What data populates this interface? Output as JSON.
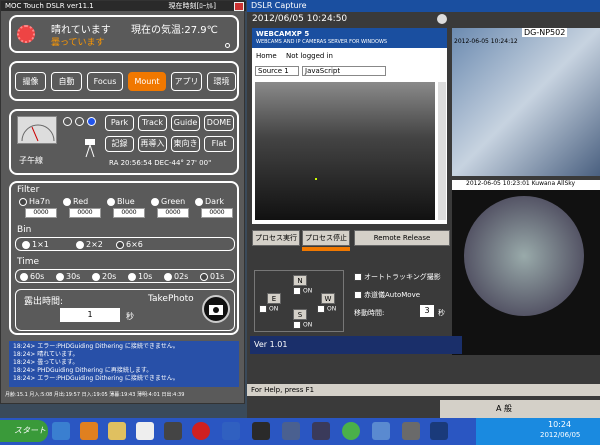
{
  "moc": {
    "title": "MOC Touch DSLR ver11.1",
    "title_right": "現在時刻[ﾛｰｶﾙ]",
    "weather": "晴れています",
    "weather_sub": "曇っています",
    "temp": "現在の気温:27.9℃",
    "tabs": [
      "撮像",
      "自動",
      "Focus",
      "Mount",
      "アプリ",
      "環境"
    ],
    "mount_buttons": [
      "Park",
      "Track",
      "Guide",
      "DOME",
      "記録",
      "再導入",
      "東向き",
      "Flat"
    ],
    "meridian_label": "子午線",
    "radec": "RA 20:56:54  DEC-44° 27' 00\"",
    "filter_label": "Filter",
    "filters": [
      {
        "name": "Ha7n",
        "count": "0000"
      },
      {
        "name": "Red",
        "count": "0000"
      },
      {
        "name": "Blue",
        "count": "0000"
      },
      {
        "name": "Green",
        "count": "0000"
      },
      {
        "name": "Dark",
        "count": "0000"
      }
    ],
    "bin_label": "Bin",
    "bins": [
      "1×1",
      "2×2",
      "6×6"
    ],
    "time_label": "Time",
    "times": [
      "60s",
      "30s",
      "20s",
      "10s",
      "02s",
      "01s"
    ],
    "exposure_label": "露出時間:",
    "exposure_value": "1",
    "exposure_unit": "秒",
    "take_photo": "TakePhoto",
    "log": [
      "18:24> エラー:PHDGuiding Dithering に接続できません。",
      "18:24> 晴れています。",
      "18:24> 曇っています。",
      "18:24> PHDGuiding Dithering に再接続します。",
      "18:24> エラー:PHDGuiding Dithering に接続できません。"
    ],
    "status_line": "月齢:15.1 月入:5:08 月出:19:57 日入:19:05 薄暮:19:43 薄明:4:01 日出:4:39"
  },
  "dslr": {
    "title": "DSLR Capture",
    "timestamp": "2012/06/05 10:24:50",
    "cam1_label": "DG-NP502",
    "cam2_label": "2012-06-05 10:23:01 Kuwana AllSky",
    "cam1_stamp": "2012-06-05 10:24:12",
    "btn_start": "プロセス実行",
    "btn_stop": "プロセス停止",
    "btn_remote": "Remote Release",
    "dir_n": "N",
    "dir_e": "E",
    "dir_w": "W",
    "dir_s": "S",
    "on": "ON",
    "auto_track": "オートトラッキング撮影",
    "auto_move": "赤道儀AutoMove",
    "move_time_label": "移動時間:",
    "move_time_value": "3",
    "move_time_unit": "秒",
    "version": "Ver 1.01",
    "help": "For Help, press F1"
  },
  "webcam": {
    "header": "WEBCAMXP 5",
    "subheader": "WEBCAMS AND IP CAMERAS SERVER FOR WINDOWS",
    "home": "Home",
    "login": "Not logged in",
    "source": "Source 1",
    "script": "JavaScript"
  },
  "taskbar": {
    "start": "スタート",
    "ime": "A 般",
    "time": "10:24",
    "date": "2012/06/05"
  }
}
